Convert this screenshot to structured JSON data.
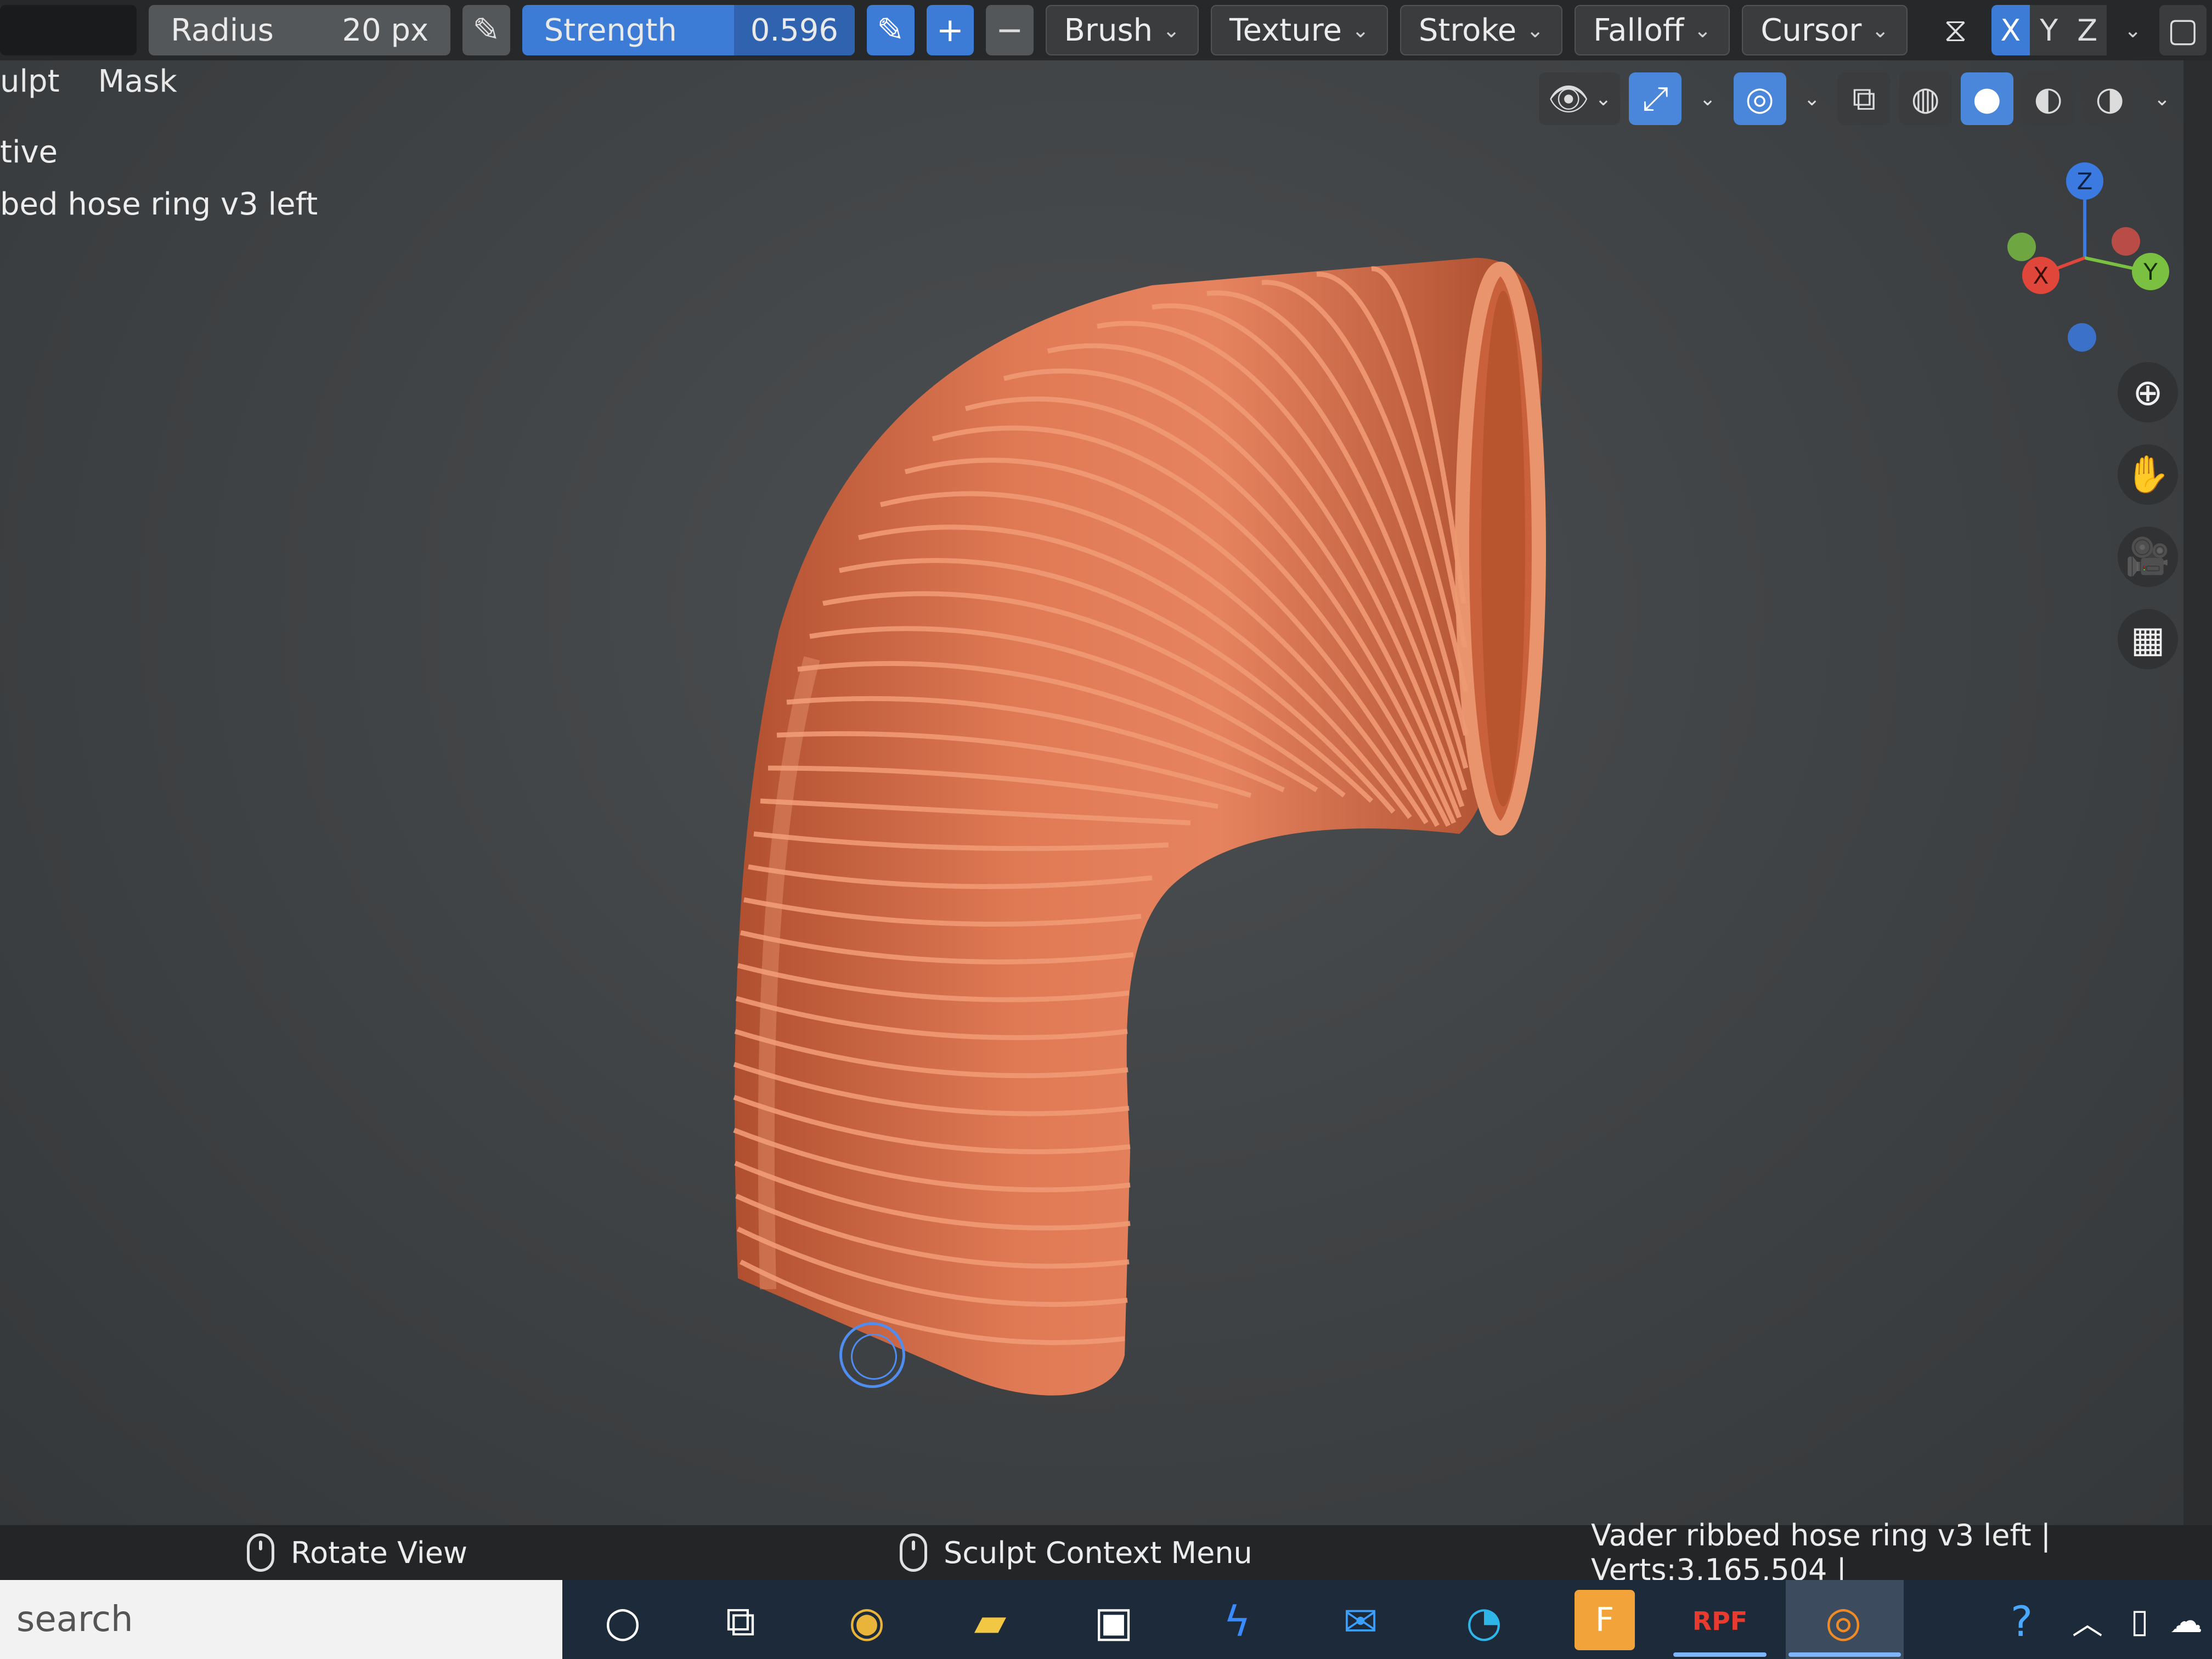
{
  "header": {
    "radius_label": "Radius",
    "radius_value": "20 px",
    "strength_label": "Strength",
    "strength_value": "0.596",
    "add_symbol": "+",
    "subtract_symbol": "−",
    "dropdowns": [
      "Brush",
      "Texture",
      "Stroke",
      "Falloff",
      "Cursor"
    ],
    "axes": [
      "X",
      "Y",
      "Z"
    ]
  },
  "menu": {
    "sculpt": "ulpt",
    "mask": "Mask"
  },
  "overlay": {
    "mode": "tive",
    "object_name": "bed hose ring v3 left"
  },
  "gizmo": {
    "x": "X",
    "y": "Y",
    "z": "Z"
  },
  "statusbar": {
    "left_hint": "Rotate View",
    "middle_hint": "Sculpt Context Menu",
    "scene_info": "Vader ribbed hose ring v3 left | Verts:3,165,504 |"
  },
  "taskbar": {
    "search_placeholder": "search",
    "rpf_label": "RPF",
    "f_label": "F"
  },
  "colors": {
    "accent": "#3c7bd6",
    "hose": "#d9724e",
    "viewport": "#414446"
  }
}
